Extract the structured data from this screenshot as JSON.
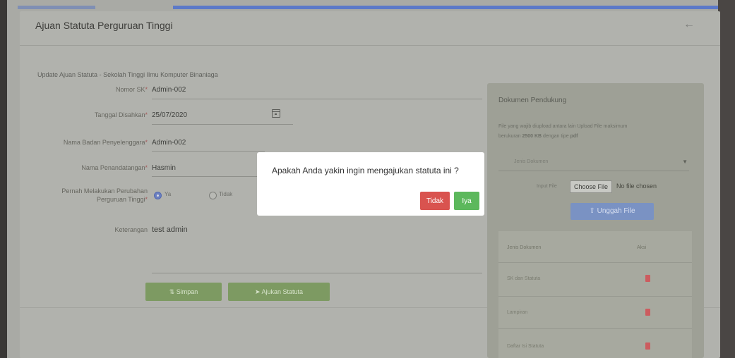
{
  "header": {
    "title": "Ajuan Statuta Perguruan Tinggi",
    "back_icon": "arrow-left-icon"
  },
  "form": {
    "subtitle": "Update Ajuan Statuta - Sekolah Tinggi Ilmu Komputer Binaniaga",
    "fields": [
      {
        "label": "Nomor SK",
        "required": "*",
        "value": "Admin-002"
      },
      {
        "label": "Tanggal Disahkan",
        "required": "*",
        "value": "25/07/2020"
      },
      {
        "label": "Nama Badan Penyelenggara",
        "required": "*",
        "value": "Admin-002"
      },
      {
        "label": "Nama Penandatangan",
        "required": "*",
        "value": "Hasmin"
      }
    ],
    "perubahan": {
      "label_line1": "Pernah Melakukan Perubahan",
      "label_line2": "Perguruan Tinggi",
      "required": "*",
      "options": [
        "Ya",
        "Tidak"
      ],
      "selected": "Ya"
    },
    "keterangan": {
      "label": "Keterangan",
      "value": "test admin"
    },
    "buttons": {
      "simpan": "Simpan",
      "ajukan": "Ajukan Statuta"
    }
  },
  "side": {
    "title": "Dokumen Pendukung",
    "note_line1": "File yang wajib diupload antara lain Upload File maksimum",
    "note_line2_prefix": "berukuran ",
    "note_size": "2500 KB",
    "note_line2_mid": " dengan tipe ",
    "note_type": "pdf",
    "select_placeholder": "Jenis Dokumen",
    "file_label": "Input File",
    "file_button": "Choose File",
    "file_status": "No file chosen",
    "upload_button": "Unggah File",
    "table_headers": [
      "Jenis Dokumen",
      "Aksi"
    ],
    "rows": [
      "SK dan Statuta",
      "Lampiran",
      "Daftar Isi Statuta"
    ]
  },
  "modal": {
    "message": "Apakah Anda yakin ingin mengajukan statuta ini ?",
    "no_label": "Tidak",
    "yes_label": "Iya"
  },
  "colors": {
    "danger": "#d9534f",
    "success": "#5cb85c",
    "primary": "#5c79c8"
  }
}
